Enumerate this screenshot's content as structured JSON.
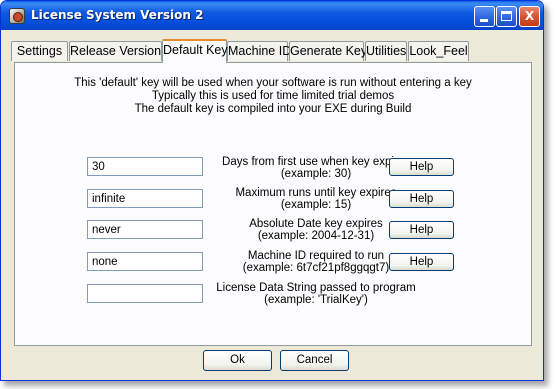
{
  "window": {
    "title": "License System Version 2",
    "close_label": "X"
  },
  "tabs": [
    {
      "label": "Settings"
    },
    {
      "label": "Release Version"
    },
    {
      "label": "Default Key",
      "active": true
    },
    {
      "label": "Machine ID"
    },
    {
      "label": "Generate Key"
    },
    {
      "label": "Utilities"
    },
    {
      "label": "Look_Feel"
    }
  ],
  "intro": {
    "line1": "This 'default' key will be used when your software is run without entering a key",
    "line2": "Typically this is used for time limited trial demos",
    "line3": "The default key is compiled into your EXE during Build"
  },
  "fields": [
    {
      "value": "30",
      "label": "Days from first use when key expires",
      "example": "(example: 30)",
      "help": "Help"
    },
    {
      "value": "infinite",
      "label": "Maximum runs until key expires",
      "example": "(example: 15)",
      "help": "Help"
    },
    {
      "value": "never",
      "label": "Absolute Date key expires",
      "example": "(example: 2004-12-31)",
      "help": "Help"
    },
    {
      "value": "none",
      "label": "Machine ID required to run",
      "example": "(example: 6t7cf21pf8ggqgt7)",
      "help": "Help"
    },
    {
      "value": "",
      "label": "License Data String passed to program",
      "example": "(example: 'TrialKey')"
    }
  ],
  "footer": {
    "ok": "Ok",
    "cancel": "Cancel"
  }
}
